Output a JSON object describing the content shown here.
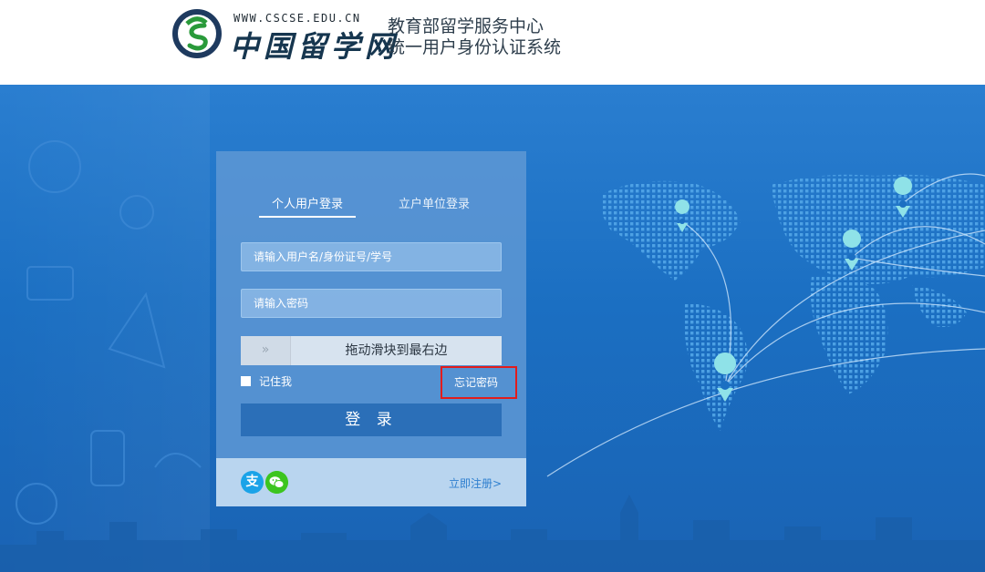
{
  "header": {
    "site_url": "WWW.CSCSE.EDU.CN",
    "site_name": "中国留学网",
    "subtitle_line1": "教育部留学服务中心",
    "subtitle_line2": "统一用户身份认证系统"
  },
  "login": {
    "tabs": [
      {
        "label": "个人用户登录",
        "active": true
      },
      {
        "label": "立户单位登录",
        "active": false
      }
    ],
    "username_placeholder": "请输入用户名/身份证号/学号",
    "password_placeholder": "请输入密码",
    "slider_arrow": "»",
    "slider_text": "拖动滑块到最右边",
    "remember_label": "记住我",
    "forgot_label": "忘记密码",
    "submit_label": "登 录",
    "alipay_glyph": "支",
    "register_label": "立即注册>"
  },
  "colors": {
    "hero_blue": "#1b6fc2",
    "card_blue": "#5c96d4",
    "button_blue": "#2b6fb8",
    "highlight_red": "#e21c1c",
    "pin_color": "#8fe2e8"
  }
}
